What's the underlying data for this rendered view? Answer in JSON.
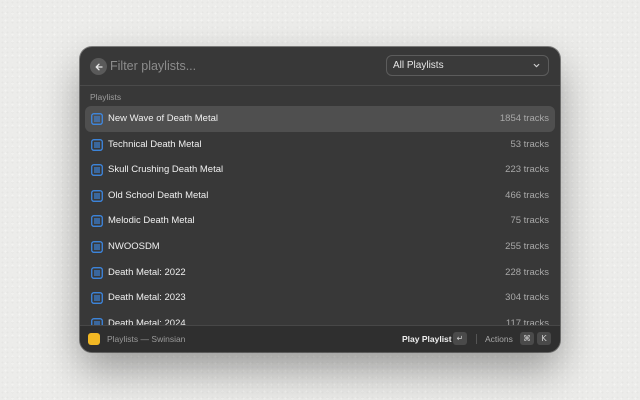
{
  "search": {
    "placeholder": "Filter playlists..."
  },
  "dropdown": {
    "selected": "All Playlists"
  },
  "section": {
    "title": "Playlists"
  },
  "playlists": [
    {
      "name": "New Wave of Death Metal",
      "count": "1854 tracks"
    },
    {
      "name": "Technical Death Metal",
      "count": "53 tracks"
    },
    {
      "name": "Skull Crushing Death Metal",
      "count": "223 tracks"
    },
    {
      "name": "Old School Death Metal",
      "count": "466 tracks"
    },
    {
      "name": "Melodic Death Metal",
      "count": "75 tracks"
    },
    {
      "name": "NWOOSDM",
      "count": "255 tracks"
    },
    {
      "name": "Death Metal: 2022",
      "count": "228 tracks"
    },
    {
      "name": "Death Metal: 2023",
      "count": "304 tracks"
    },
    {
      "name": "Death Metal: 2024",
      "count": "117 tracks"
    }
  ],
  "footer": {
    "app_title": "Playlists — Swinsian",
    "primary_action": "Play Playlist",
    "enter_key": "↵",
    "actions_label": "Actions",
    "cmd_key": "⌘",
    "k_key": "K"
  },
  "colors": {
    "accent_icon": "#3d8ef0",
    "app_icon": "#f2b824",
    "selected_row": "#4f4f4f"
  },
  "icons": {
    "back": "arrow-left-icon",
    "dropdown": "chevron-down-icon",
    "playlist": "playlist-icon"
  }
}
